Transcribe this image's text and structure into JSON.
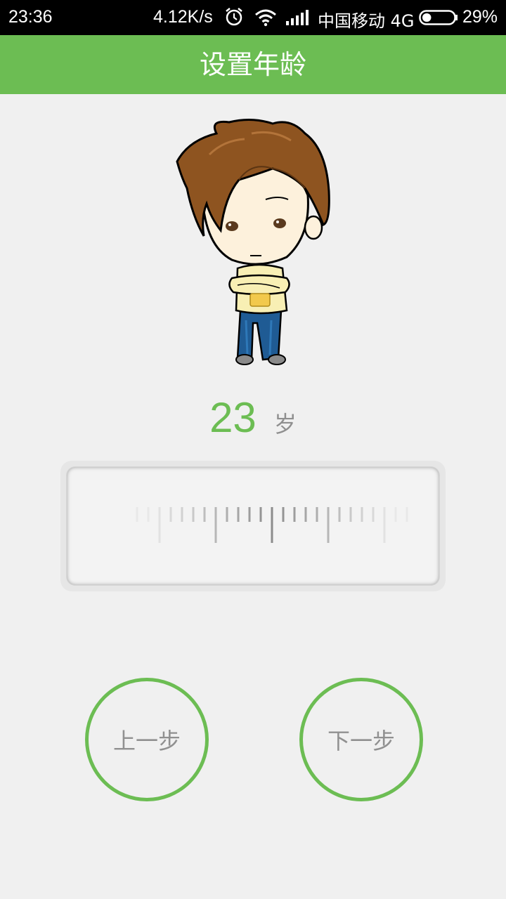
{
  "status_bar": {
    "time": "23:36",
    "net_speed": "4.12K/s",
    "carrier": "中国移动 4G",
    "battery_pct": "29%",
    "battery_level": 0.29,
    "icons": [
      "alarm-icon",
      "wifi-icon",
      "signal-icon",
      "battery-icon"
    ]
  },
  "header": {
    "title": "设置年龄"
  },
  "avatar": {
    "icon": "cartoon-boy-avatar"
  },
  "age": {
    "value": "23",
    "unit": "岁"
  },
  "ruler": {
    "selected_value": 23
  },
  "buttons": {
    "prev_label": "上一步",
    "next_label": "下一步"
  },
  "colors": {
    "accent": "#6cbd53",
    "background": "#f0f0f0",
    "button_text": "#909090"
  }
}
